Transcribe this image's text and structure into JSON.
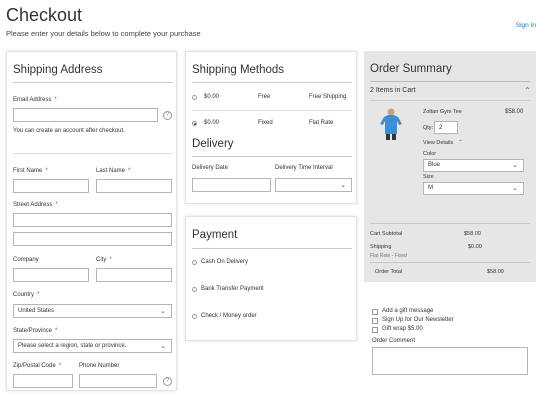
{
  "header": {
    "title": "Checkout",
    "subtitle": "Please enter your details below to complete your purchase",
    "signin": "Sign In"
  },
  "shipping_address": {
    "title": "Shipping Address",
    "email_label": "Email Address",
    "email_note": "You can create an account after checkout.",
    "first_name_label": "First Name",
    "last_name_label": "Last Name",
    "street_label": "Street Address",
    "company_label": "Company",
    "city_label": "City",
    "country_label": "Country",
    "country_value": "United States",
    "state_label": "State/Province",
    "state_value": "Please select a region, state or province.",
    "zip_label": "Zip/Postal Code",
    "phone_label": "Phone Number",
    "required_mark": "*",
    "help_mark": "?"
  },
  "shipping_methods": {
    "title": "Shipping Methods",
    "options": [
      {
        "price": "$0.00",
        "name": "Free",
        "carrier": "Free Shipping",
        "selected": false
      },
      {
        "price": "$0.00",
        "name": "Fixed",
        "carrier": "Flat Rate",
        "selected": true
      }
    ]
  },
  "delivery": {
    "title": "Delivery",
    "date_label": "Delivery Date",
    "interval_label": "Delivery Time Interval"
  },
  "payment": {
    "title": "Payment",
    "options": [
      "Cash On Delivery",
      "Bank Transfer Payment",
      "Check / Money order"
    ]
  },
  "order_summary": {
    "title": "Order Summary",
    "items_in_cart": "2 Items in Cart",
    "item": {
      "name": "Zoltan Gym Tee",
      "price": "$58.00",
      "qty_label": "Qty:",
      "qty": "2",
      "view_details": "View Details",
      "color_label": "Color",
      "color_value": "Blue",
      "size_label": "Size",
      "size_value": "M"
    },
    "cart_subtotal_label": "Cart Subtotal",
    "cart_subtotal": "$58.00",
    "shipping_label": "Shipping",
    "shipping_sub": "Flat Rate - Fixed",
    "shipping_value": "$0.00",
    "order_total_label": "Order Total",
    "order_total": "$58.00"
  },
  "extras": {
    "gift_message": "Add a gift message",
    "newsletter": "Sign Up for Our Newsletter",
    "gift_wrap": "Gift wrap $5.00",
    "order_comment_label": "Order Comment"
  },
  "colors": {
    "link": "#1979c3",
    "required": "#e02b27",
    "summary_bg": "#e6e6e6",
    "tee_blue": "#3d8fd1"
  }
}
